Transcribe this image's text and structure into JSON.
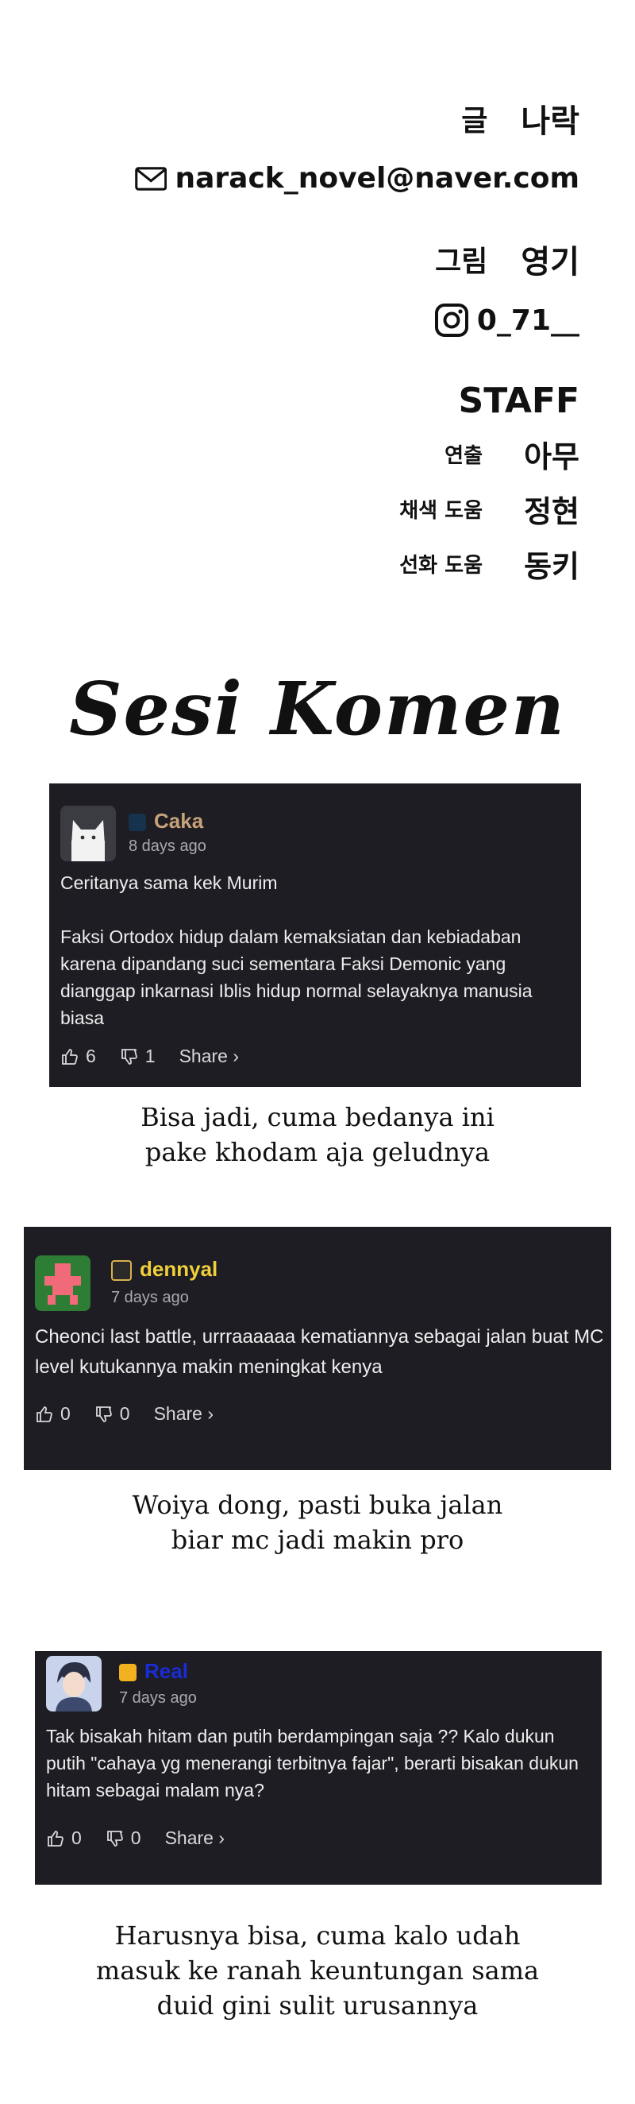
{
  "credits": {
    "writer_label": "글",
    "writer_name": "나락",
    "email": "narack_novel@naver.com",
    "artist_label": "그림",
    "artist_name": "영기",
    "instagram": "0_71__",
    "staff_title": "STAFF",
    "staff": [
      {
        "role": "연출",
        "name": "아무"
      },
      {
        "role": "채색 도움",
        "name": "정현"
      },
      {
        "role": "선화 도움",
        "name": "동키"
      }
    ]
  },
  "headline": "Sesi Komen",
  "comments": [
    {
      "username": "Caka",
      "username_color": "#c7a27a",
      "time": "8 days ago",
      "text": "Ceritanya sama kek Murim\n\nFaksi Ortodox hidup dalam kemaksiatan dan kebiadaban karena dipandang suci sementara Faksi Demonic yang dianggap inkarnasi Iblis hidup normal selayaknya manusia biasa",
      "likes": "6",
      "dislikes": "1",
      "share": "Share ›"
    },
    {
      "username": "dennyal",
      "username_color": "#f0cf3a",
      "time": "7 days ago",
      "text": "Cheonci last battle, urrraaaaaa kematiannya sebagai jalan buat MC level kutukannya makin meningkat kenya",
      "likes": "0",
      "dislikes": "0",
      "share": "Share ›"
    },
    {
      "username": "Real",
      "username_color": "#1a2bd8",
      "time": "7 days ago",
      "text": "Tak bisakah hitam dan putih berdampingan saja ?? Kalo dukun putih \"cahaya yg menerangi terbitnya fajar\", berarti bisakan dukun hitam sebagai malam nya?",
      "likes": "0",
      "dislikes": "0",
      "share": "Share ›"
    }
  ],
  "replies": [
    "Bisa jadi, cuma bedanya ini\npake khodam aja geludnya",
    "Woiya dong, pasti buka jalan\nbiar mc jadi makin pro",
    "Harusnya bisa, cuma kalo udah\nmasuk ke ranah keuntungan sama\nduid gini sulit urusannya"
  ]
}
